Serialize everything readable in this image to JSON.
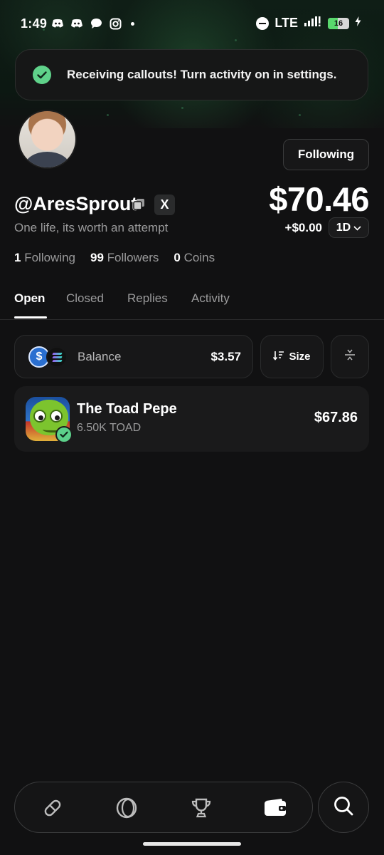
{
  "status_bar": {
    "time": "1:49",
    "network": "LTE",
    "battery": "16"
  },
  "toast": {
    "message": "Receiving callouts! Turn activity on in settings."
  },
  "profile": {
    "handle": "@AresSprout",
    "bio": "One life, its worth an attempt",
    "follow_button": "Following",
    "x_label": "X",
    "portfolio_value": "$70.46",
    "change": "+$0.00",
    "range": "1D",
    "stats": [
      {
        "count": "1",
        "label": "Following"
      },
      {
        "count": "99",
        "label": "Followers"
      },
      {
        "count": "0",
        "label": "Coins"
      }
    ]
  },
  "tabs": [
    {
      "label": "Open",
      "active": true
    },
    {
      "label": "Closed",
      "active": false
    },
    {
      "label": "Replies",
      "active": false
    },
    {
      "label": "Activity",
      "active": false
    }
  ],
  "balance": {
    "label": "Balance",
    "value": "$3.57",
    "usdc_symbol": "$"
  },
  "sort_button": {
    "label": "Size"
  },
  "holdings": [
    {
      "name": "The Toad Pepe",
      "amount": "6.50K TOAD",
      "value": "$67.86"
    }
  ],
  "colors": {
    "background": "#111112",
    "accent_green": "#5fd28a",
    "card": "#171718",
    "muted_text": "#9a9a9b"
  },
  "nav": {
    "items": [
      "pill-icon",
      "circle-icon",
      "trophy-icon",
      "wallet-icon"
    ],
    "search": "search-icon"
  }
}
